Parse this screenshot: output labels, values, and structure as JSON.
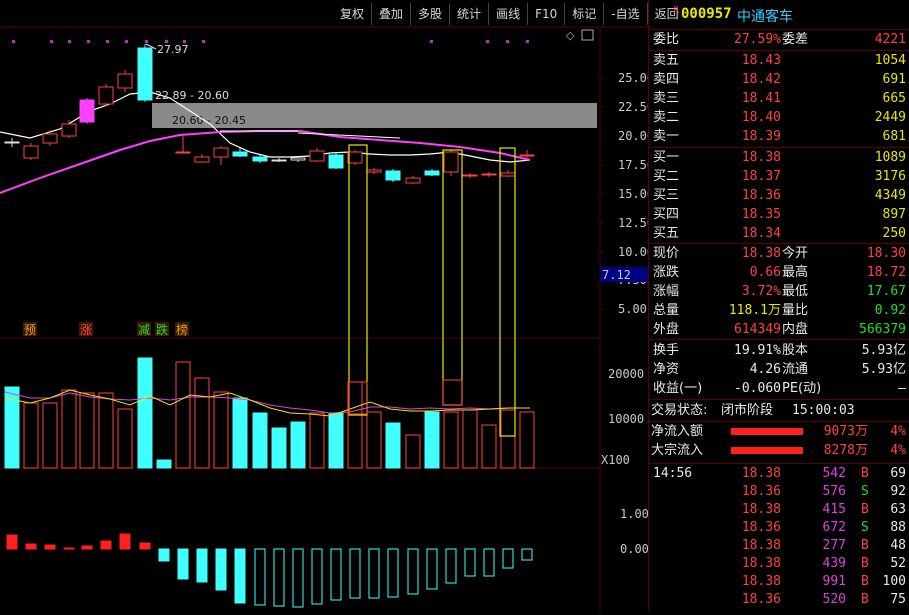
{
  "toolbar": [
    "复权",
    "叠加",
    "多股",
    "统计",
    "画线",
    "F10",
    "标记",
    "-自选",
    "返回"
  ],
  "chart": {
    "price_axis": [
      "25.00",
      "22.50",
      "20.00",
      "17.50",
      "15.00",
      "12.50",
      "10.00",
      "7.50",
      "5.00"
    ],
    "current_price_tag": "7.12",
    "high_label": "27.97",
    "zone1_label": "22.89 - 20.60",
    "zone2_label": "20.60 - 20.45",
    "markers": [
      {
        "text": "预",
        "color": "#e8a000"
      },
      {
        "text": "涨",
        "color": "#ff4040"
      },
      {
        "text": "减",
        "color": "#22dd22"
      },
      {
        "text": "跌",
        "color": "#22dd22"
      },
      {
        "text": "榜",
        "color": "#e8a000"
      }
    ],
    "volume_axis": [
      "20000",
      "10000"
    ],
    "volume_unit": "X100",
    "macd_axis": [
      "1.00",
      "0.00"
    ]
  },
  "quote": {
    "badge": "R",
    "code": "000957",
    "name": "中通客车",
    "weibi_label": "委比",
    "weibi_value": "27.59%",
    "weicha_label": "委差",
    "weicha_value": "4221",
    "asks": [
      {
        "label": "卖五",
        "price": "18.43",
        "vol": "1054"
      },
      {
        "label": "卖四",
        "price": "18.42",
        "vol": "691"
      },
      {
        "label": "卖三",
        "price": "18.41",
        "vol": "665"
      },
      {
        "label": "卖二",
        "price": "18.40",
        "vol": "2449"
      },
      {
        "label": "卖一",
        "price": "18.39",
        "vol": "681"
      }
    ],
    "bids": [
      {
        "label": "买一",
        "price": "18.38",
        "vol": "1089"
      },
      {
        "label": "买二",
        "price": "18.37",
        "vol": "3176"
      },
      {
        "label": "买三",
        "price": "18.36",
        "vol": "4349"
      },
      {
        "label": "买四",
        "price": "18.35",
        "vol": "897"
      },
      {
        "label": "买五",
        "price": "18.34",
        "vol": "250"
      }
    ],
    "stats": [
      {
        "l1": "现价",
        "v1": "18.38",
        "c1": "red",
        "l2": "今开",
        "v2": "18.30",
        "c2": "red"
      },
      {
        "l1": "涨跌",
        "v1": "0.66",
        "c1": "red",
        "l2": "最高",
        "v2": "18.72",
        "c2": "red"
      },
      {
        "l1": "涨幅",
        "v1": "3.72%",
        "c1": "red",
        "l2": "最低",
        "v2": "17.67",
        "c2": "green"
      },
      {
        "l1": "总量",
        "v1": "118.1万",
        "c1": "yellow",
        "l2": "量比",
        "v2": "0.92",
        "c2": "green"
      },
      {
        "l1": "外盘",
        "v1": "614349",
        "c1": "red",
        "l2": "内盘",
        "v2": "566379",
        "c2": "green"
      }
    ],
    "stats2": [
      {
        "l1": "换手",
        "v1": "19.91%",
        "l2": "股本",
        "v2": "5.93亿"
      },
      {
        "l1": "净资",
        "v1": "4.26",
        "l2": "流通",
        "v2": "5.93亿"
      },
      {
        "l1": "收益(一)",
        "v1": "-0.060",
        "l2": "PE(动)",
        "v2": "–"
      }
    ],
    "trade_status_label": "交易状态:",
    "trade_status": "闭市阶段",
    "trade_time": "15:00:03",
    "flows": [
      {
        "label": "净流入额",
        "value": "9073万",
        "pct": "4%"
      },
      {
        "label": "大宗流入",
        "value": "8278万",
        "pct": "4%"
      }
    ],
    "ticks": [
      {
        "time": "14:56",
        "price": "18.38",
        "vol": "542",
        "side": "B",
        "cnt": "69"
      },
      {
        "time": "",
        "price": "18.36",
        "vol": "576",
        "side": "S",
        "cnt": "92"
      },
      {
        "time": "",
        "price": "18.38",
        "vol": "415",
        "side": "B",
        "cnt": "63"
      },
      {
        "time": "",
        "price": "18.36",
        "vol": "672",
        "side": "S",
        "cnt": "88"
      },
      {
        "time": "",
        "price": "18.38",
        "vol": "277",
        "side": "B",
        "cnt": "48"
      },
      {
        "time": "",
        "price": "18.38",
        "vol": "439",
        "side": "B",
        "cnt": "52"
      },
      {
        "time": "",
        "price": "18.38",
        "vol": "991",
        "side": "B",
        "cnt": "100"
      },
      {
        "time": "",
        "price": "18.36",
        "vol": "520",
        "side": "B",
        "cnt": "75"
      }
    ]
  }
}
